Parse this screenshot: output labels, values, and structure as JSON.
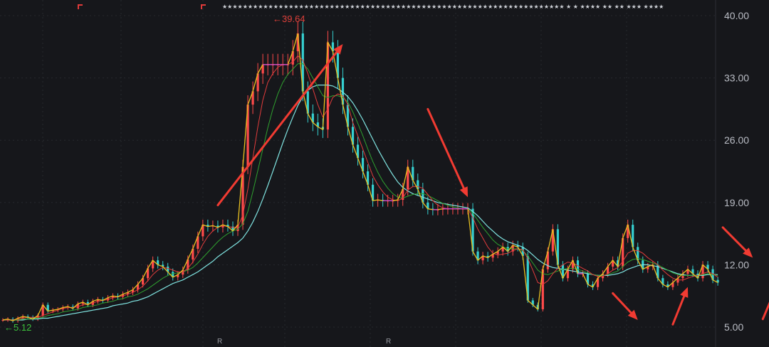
{
  "chart_data": {
    "type": "line",
    "chart_style": "candlestick price chart with moving averages",
    "ylim": [
      5,
      40
    ],
    "y_ticks": [
      "40.00",
      "33.00",
      "26.00",
      "19.00",
      "12.00",
      "5.00"
    ],
    "y_tick_values": [
      40,
      33,
      26,
      19,
      12,
      5
    ],
    "high_label": "39.64",
    "high_value": 39.64,
    "low_label": "5.12",
    "low_value": 5.12,
    "marker_labels": [
      "R",
      "R"
    ],
    "star_strip": "★★★★★★★★★★★★★★★★★★★★★★★★★★★★★★★★★★★★★★★★★★★★★★★★★★★★★★★★★★★★★★★★★★★ ★ ★ ★★★★ ★★ ★★ ★★★ ★★★★",
    "x_count": 140,
    "price": [
      5.8,
      5.9,
      5.7,
      6.0,
      6.2,
      6.1,
      5.9,
      6.3,
      7.5,
      6.8,
      6.9,
      7.0,
      7.2,
      7.3,
      7.1,
      7.6,
      7.8,
      7.5,
      7.9,
      8.1,
      8.0,
      8.3,
      8.5,
      8.4,
      8.7,
      8.9,
      9.2,
      9.8,
      10.5,
      11.6,
      12.5,
      12.0,
      11.8,
      11.2,
      10.6,
      10.9,
      11.4,
      12.6,
      13.8,
      15.2,
      16.5,
      16.3,
      16.4,
      16.2,
      16.5,
      16.3,
      15.8,
      16.5,
      23.0,
      30.0,
      31.5,
      33.5,
      34.5,
      34.5,
      34.5,
      34.5,
      34.5,
      34.5,
      36.0,
      38.0,
      31.5,
      29.0,
      28.0,
      27.5,
      27.2,
      37.0,
      36.0,
      33.0,
      30.0,
      27.5,
      25.5,
      24.0,
      22.5,
      21.0,
      19.2,
      19.3,
      19.2,
      19.2,
      19.2,
      19.3,
      20.5,
      23.0,
      21.5,
      20.5,
      19.0,
      18.3,
      18.2,
      18.2,
      18.3,
      18.3,
      18.3,
      18.3,
      18.3,
      18.3,
      13.5,
      12.5,
      13.0,
      12.8,
      13.2,
      13.5,
      14.0,
      13.5,
      14.2,
      14.0,
      13.0,
      8.0,
      7.5,
      7.0,
      11.5,
      13.5,
      16.0,
      12.0,
      10.5,
      11.5,
      12.5,
      11.0,
      11.0,
      9.8,
      9.5,
      10.5,
      11.0,
      11.8,
      12.5,
      11.8,
      15.0,
      16.5,
      14.0,
      12.5,
      11.5,
      11.8,
      12.0,
      10.5,
      9.8,
      9.5,
      10.0,
      10.5,
      11.0,
      11.5,
      11.0,
      10.5,
      12.0,
      11.5,
      10.3,
      10.0
    ],
    "ma_short": [
      5.8,
      5.8,
      5.8,
      5.9,
      6.0,
      6.1,
      6.1,
      6.1,
      6.3,
      6.5,
      6.7,
      6.9,
      7.1,
      7.2,
      7.2,
      7.3,
      7.5,
      7.6,
      7.7,
      7.9,
      8.0,
      8.1,
      8.3,
      8.4,
      8.5,
      8.7,
      8.9,
      9.2,
      9.6,
      10.2,
      10.9,
      11.4,
      11.7,
      11.6,
      11.4,
      11.2,
      11.2,
      11.6,
      12.3,
      13.2,
      14.3,
      15.2,
      15.8,
      16.2,
      16.4,
      16.3,
      16.2,
      16.2,
      17.6,
      20.5,
      24.0,
      27.5,
      30.5,
      32.5,
      33.5,
      34.2,
      34.5,
      34.5,
      34.8,
      35.5,
      35.0,
      33.5,
      31.8,
      30.0,
      28.6,
      29.5,
      30.8,
      31.2,
      31.0,
      30.0,
      28.0,
      26.5,
      25.0,
      23.5,
      22.0,
      21.0,
      20.2,
      19.6,
      19.3,
      19.2,
      19.5,
      20.4,
      20.8,
      20.8,
      20.6,
      19.9,
      19.2,
      18.7,
      18.4,
      18.3,
      18.3,
      18.3,
      18.3,
      18.3,
      17.3,
      16.0,
      15.0,
      14.0,
      13.3,
      13.1,
      13.2,
      13.3,
      13.6,
      13.8,
      13.7,
      12.7,
      11.4,
      10.0,
      9.8,
      10.2,
      11.0,
      11.6,
      12.0,
      12.3,
      12.2,
      11.9,
      11.6,
      11.3,
      10.9,
      10.7,
      10.7,
      11.0,
      11.4,
      11.7,
      12.4,
      13.3,
      13.6,
      13.6,
      13.3,
      12.8,
      12.4,
      12.0,
      11.4,
      10.9,
      10.5,
      10.3,
      10.3,
      10.5,
      10.7,
      10.8,
      11.0,
      11.2,
      11.0,
      10.6
    ],
    "ma_mid": [
      5.8,
      5.8,
      5.8,
      5.8,
      5.9,
      5.9,
      6.0,
      6.0,
      6.1,
      6.3,
      6.4,
      6.5,
      6.7,
      6.8,
      6.9,
      7.0,
      7.2,
      7.3,
      7.4,
      7.5,
      7.7,
      7.8,
      7.9,
      8.1,
      8.2,
      8.4,
      8.5,
      8.7,
      9.0,
      9.3,
      9.7,
      10.1,
      10.5,
      10.8,
      11.0,
      11.1,
      11.2,
      11.4,
      11.7,
      12.2,
      12.8,
      13.4,
      14.0,
      14.6,
      15.1,
      15.5,
      15.8,
      16.0,
      16.6,
      18.0,
      20.2,
      22.6,
      25.0,
      27.4,
      29.5,
      31.2,
      32.5,
      33.4,
      34.0,
      34.6,
      34.6,
      34.0,
      33.0,
      32.0,
      31.0,
      30.8,
      31.0,
      31.0,
      30.8,
      30.3,
      29.2,
      27.9,
      26.5,
      25.0,
      23.6,
      22.4,
      21.4,
      20.6,
      20.0,
      19.6,
      19.5,
      19.7,
      19.9,
      20.0,
      20.0,
      19.8,
      19.5,
      19.2,
      18.9,
      18.7,
      18.5,
      18.4,
      18.3,
      18.3,
      17.8,
      17.0,
      16.2,
      15.5,
      14.8,
      14.3,
      14.0,
      13.8,
      13.8,
      13.8,
      13.6,
      13.0,
      12.2,
      11.4,
      11.0,
      10.9,
      11.1,
      11.3,
      11.5,
      11.6,
      11.6,
      11.5,
      11.3,
      11.1,
      10.9,
      10.8,
      10.8,
      10.9,
      11.1,
      11.3,
      11.8,
      12.3,
      12.6,
      12.7,
      12.6,
      12.4,
      12.2,
      12.0,
      11.7,
      11.4,
      11.1,
      10.9,
      10.8,
      10.8,
      10.8,
      10.8,
      10.9,
      11.0,
      10.9,
      10.8
    ],
    "ma_long": [
      5.8,
      5.8,
      5.8,
      5.8,
      5.8,
      5.9,
      5.9,
      5.9,
      6.0,
      6.0,
      6.1,
      6.2,
      6.3,
      6.4,
      6.5,
      6.6,
      6.7,
      6.8,
      6.9,
      7.0,
      7.1,
      7.2,
      7.4,
      7.5,
      7.6,
      7.7,
      7.9,
      8.0,
      8.2,
      8.4,
      8.7,
      9.0,
      9.3,
      9.6,
      9.9,
      10.1,
      10.3,
      10.6,
      10.9,
      11.2,
      11.6,
      12.0,
      12.4,
      12.9,
      13.3,
      13.7,
      14.1,
      14.5,
      15.0,
      15.8,
      16.8,
      18.0,
      19.4,
      20.9,
      22.5,
      24.1,
      25.7,
      27.2,
      28.6,
      29.9,
      30.9,
      31.6,
      32.0,
      32.2,
      32.2,
      32.2,
      32.1,
      31.8,
      31.4,
      30.9,
      30.2,
      29.3,
      28.3,
      27.2,
      26.1,
      25.0,
      24.0,
      23.0,
      22.1,
      21.3,
      20.7,
      20.3,
      20.0,
      19.8,
      19.6,
      19.4,
      19.2,
      19.0,
      18.9,
      18.8,
      18.7,
      18.6,
      18.5,
      18.4,
      18.0,
      17.5,
      16.9,
      16.3,
      15.8,
      15.3,
      14.9,
      14.6,
      14.4,
      14.2,
      14.0,
      13.6,
      13.1,
      12.6,
      12.2,
      11.9,
      11.7,
      11.6,
      11.5,
      11.4,
      11.3,
      11.2,
      11.1,
      11.0,
      10.9,
      10.8,
      10.8,
      10.8,
      10.9,
      11.0,
      11.2,
      11.5,
      11.7,
      11.9,
      12.0,
      12.0,
      11.9,
      11.8,
      11.6,
      11.4,
      11.2,
      11.0,
      10.9,
      10.8,
      10.8,
      10.8,
      10.8,
      10.9,
      10.9,
      10.9
    ],
    "annotation_arrows": [
      {
        "from": [
          43,
          18.7
        ],
        "to": [
          68,
          36.8
        ]
      },
      {
        "from": [
          85,
          29.5
        ],
        "to": [
          93,
          19.6
        ]
      },
      {
        "from": [
          122,
          8.8
        ],
        "to": [
          127,
          5.8
        ]
      },
      {
        "from": [
          134,
          5.3
        ],
        "to": [
          137,
          9.5
        ]
      },
      {
        "from": [
          144,
          16.2
        ],
        "to": [
          150,
          12.8
        ]
      },
      {
        "from": [
          152,
          5.9
        ],
        "to": [
          157,
          12.5
        ]
      }
    ],
    "grid": true,
    "colors": {
      "background": "#16171b",
      "price": "#e8c020",
      "ma_short": "#e23c3c",
      "ma_mid": "#2fa02f",
      "ma_long": "#7fe3e0",
      "flat_step": "#cc44cc",
      "annotation": "#f13b32",
      "axis_text": "#b9bcc4",
      "high_label": "#e0403a",
      "low_label": "#3cc03c",
      "grid": "#26282e"
    }
  }
}
